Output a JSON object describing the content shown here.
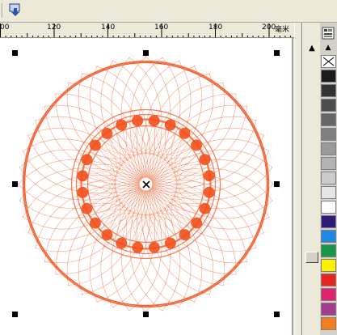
{
  "toolbar": {
    "items": [
      {
        "name": "separator"
      },
      {
        "name": "docker-icon"
      }
    ]
  },
  "ruler": {
    "labels": [
      "00",
      "120",
      "140",
      "160",
      "180",
      "200"
    ],
    "units": "毫米"
  },
  "palette": {
    "swatches": [
      {
        "name": "swatch-none",
        "color": "none"
      },
      {
        "name": "swatch-black",
        "color": "#1a1a1a"
      },
      {
        "name": "swatch-90-black",
        "color": "#333333"
      },
      {
        "name": "swatch-80-black",
        "color": "#4d4d4d"
      },
      {
        "name": "swatch-70-black",
        "color": "#666666"
      },
      {
        "name": "swatch-60-black",
        "color": "#808080"
      },
      {
        "name": "swatch-50-black",
        "color": "#999999"
      },
      {
        "name": "swatch-40-black",
        "color": "#b3b3b3"
      },
      {
        "name": "swatch-30-black",
        "color": "#cccccc"
      },
      {
        "name": "swatch-10-black",
        "color": "#e6e6e6"
      },
      {
        "name": "swatch-white",
        "color": "#ffffff"
      },
      {
        "name": "swatch-navy",
        "color": "#2e1a78"
      },
      {
        "name": "swatch-blue",
        "color": "#1e88e5"
      },
      {
        "name": "swatch-green",
        "color": "#16964a"
      },
      {
        "name": "swatch-yellow",
        "color": "#fff200"
      },
      {
        "name": "swatch-red",
        "color": "#e8251c"
      },
      {
        "name": "swatch-magenta",
        "color": "#e02272"
      },
      {
        "name": "swatch-purple",
        "color": "#a63a8c"
      },
      {
        "name": "swatch-orange",
        "color": "#f47d20"
      }
    ]
  },
  "artwork": {
    "color": "#f2501c"
  }
}
